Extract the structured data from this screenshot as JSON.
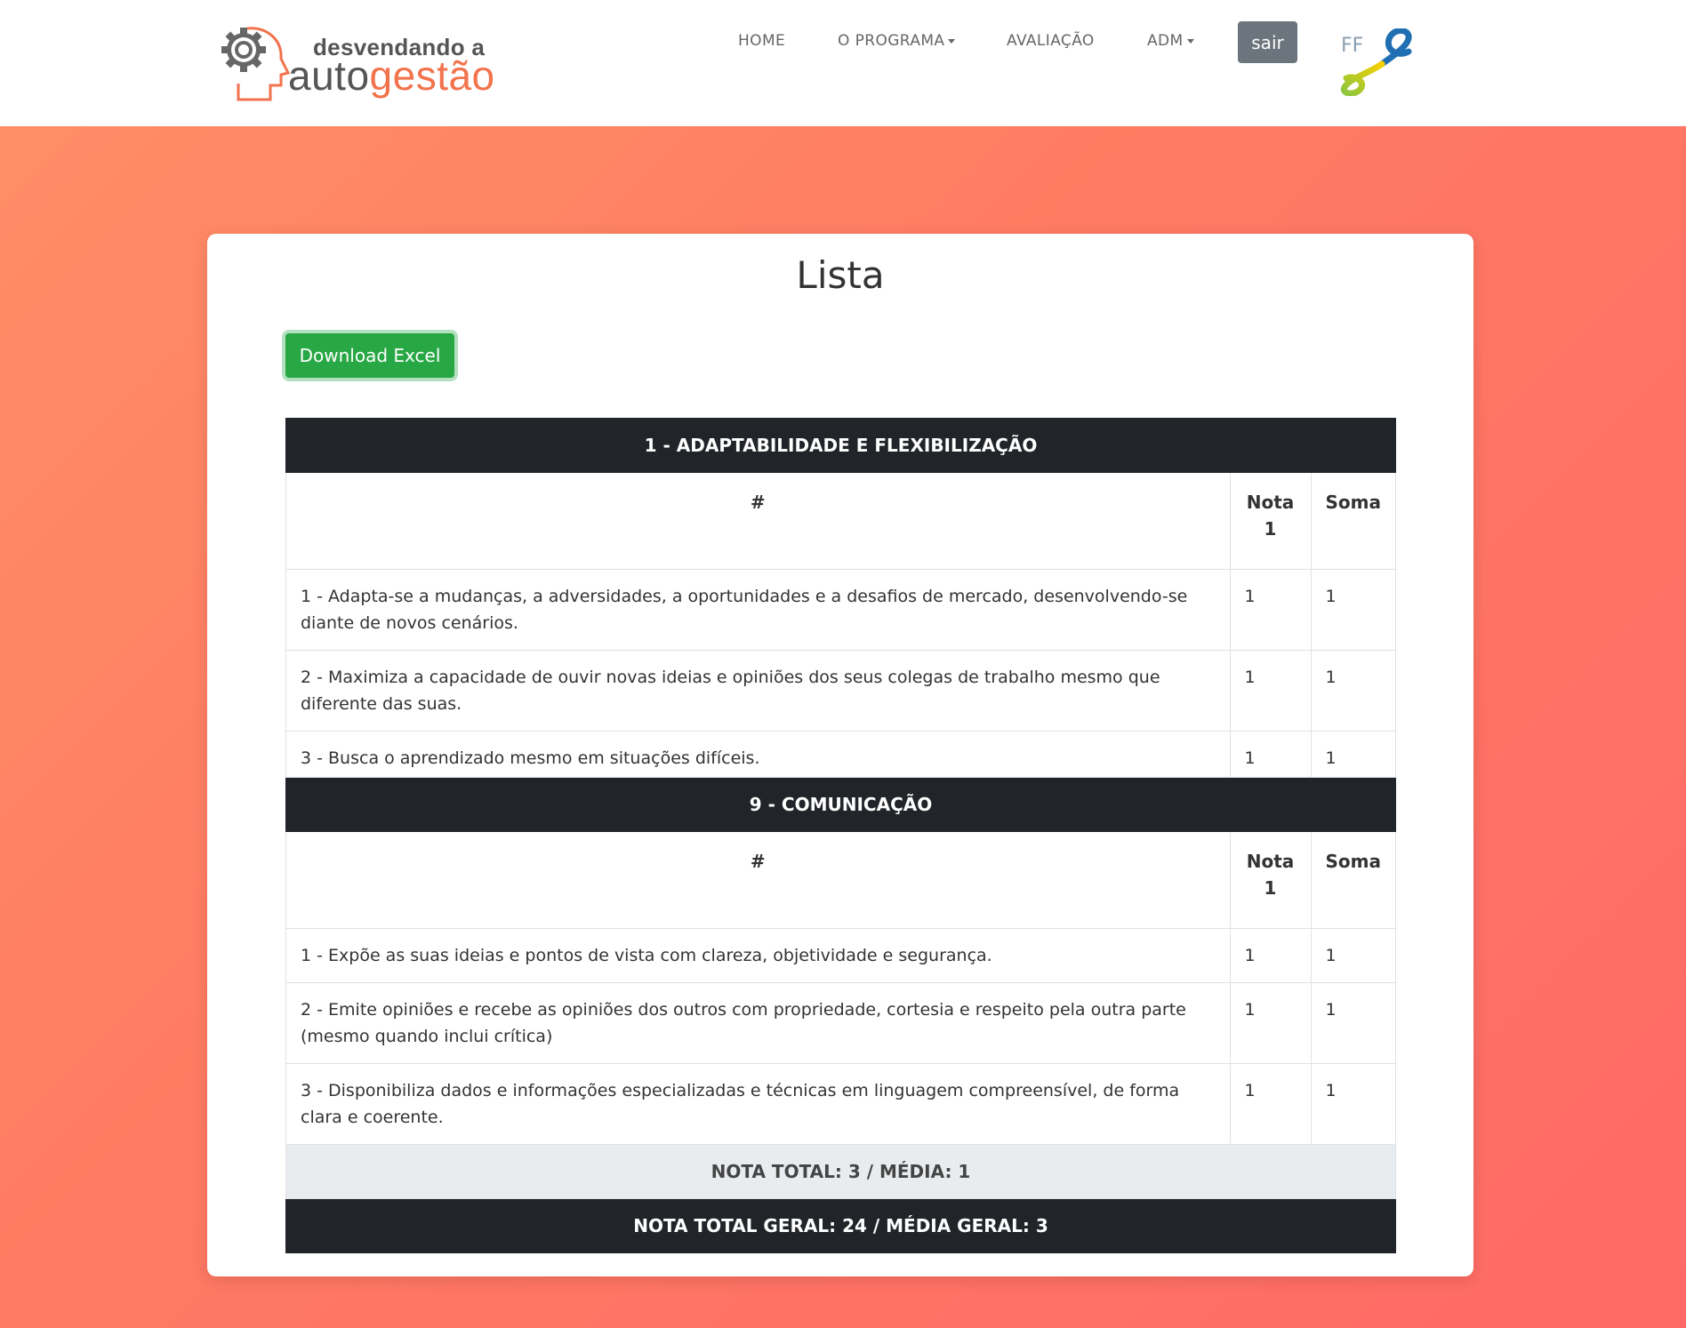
{
  "header": {
    "logo_small": "desvendando a",
    "logo_big_part1": "auto",
    "logo_big_part2": "gestão",
    "nav": [
      {
        "label": "HOME"
      },
      {
        "label": "O PROGRAMA"
      },
      {
        "label": "AVALIAÇÃO"
      },
      {
        "label": "ADM"
      }
    ],
    "logout_label": "sair",
    "partner_logo_text": "FF"
  },
  "main": {
    "title": "Lista",
    "download_label": "Download Excel",
    "col_hash": "#",
    "col_nota": "Nota 1",
    "col_soma": "Soma",
    "sections": [
      {
        "title": "1 - ADAPTABILIDADE E FLEXIBILIZAÇÃO",
        "rows": [
          {
            "text": "1 - Adapta-se a mudanças, a adversidades, a oportunidades e a desafios de mercado, desenvolvendo-se diante de novos cenários.",
            "nota": "1",
            "soma": "1"
          },
          {
            "text": "2 - Maximiza a capacidade de ouvir novas ideias e opiniões dos seus colegas de trabalho mesmo que diferente das suas.",
            "nota": "1",
            "soma": "1"
          },
          {
            "text": "3 - Busca o aprendizado mesmo em situações difíceis.",
            "nota": "1",
            "soma": "1"
          }
        ]
      },
      {
        "title": "9 - COMUNICAÇÃO",
        "rows": [
          {
            "text": "1 - Expõe as suas ideias e pontos de vista com clareza, objetividade e segurança.",
            "nota": "1",
            "soma": "1"
          },
          {
            "text": "2 - Emite opiniões e recebe as opiniões dos outros com propriedade, cortesia e respeito pela outra parte (mesmo quando inclui crítica)",
            "nota": "1",
            "soma": "1"
          },
          {
            "text": "3 - Disponibiliza dados e informações especializadas e técnicas em linguagem compreensível, de forma clara e coerente.",
            "nota": "1",
            "soma": "1"
          }
        ]
      }
    ],
    "total": "NOTA TOTAL: 3 / MÉDIA: 1",
    "grand_total": "NOTA TOTAL GERAL: 24 / MÉDIA GERAL: 3"
  },
  "colors": {
    "accent_orange": "#f2734d",
    "download_green": "#28a745",
    "dark": "#212529",
    "logout_gray": "#6c757d"
  }
}
